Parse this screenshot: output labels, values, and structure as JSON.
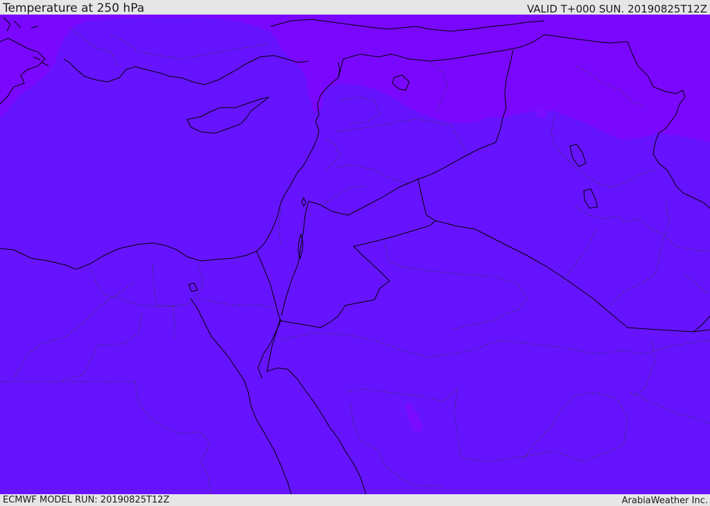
{
  "header": {
    "title": "Temperature at 250 hPa",
    "valid": "VALID T+000 SUN. 20190825T12Z"
  },
  "footer": {
    "model_run": "ECMWF MODEL RUN: 20190825T12Z",
    "credit": "ArabiaWeather Inc."
  },
  "colors": {
    "field_main": "#6614ff",
    "field_cold": "#7a08ff",
    "coastline": "#000000",
    "border": "#000000",
    "admin_border": "#333344",
    "bar_background": "#e6e6e6"
  }
}
